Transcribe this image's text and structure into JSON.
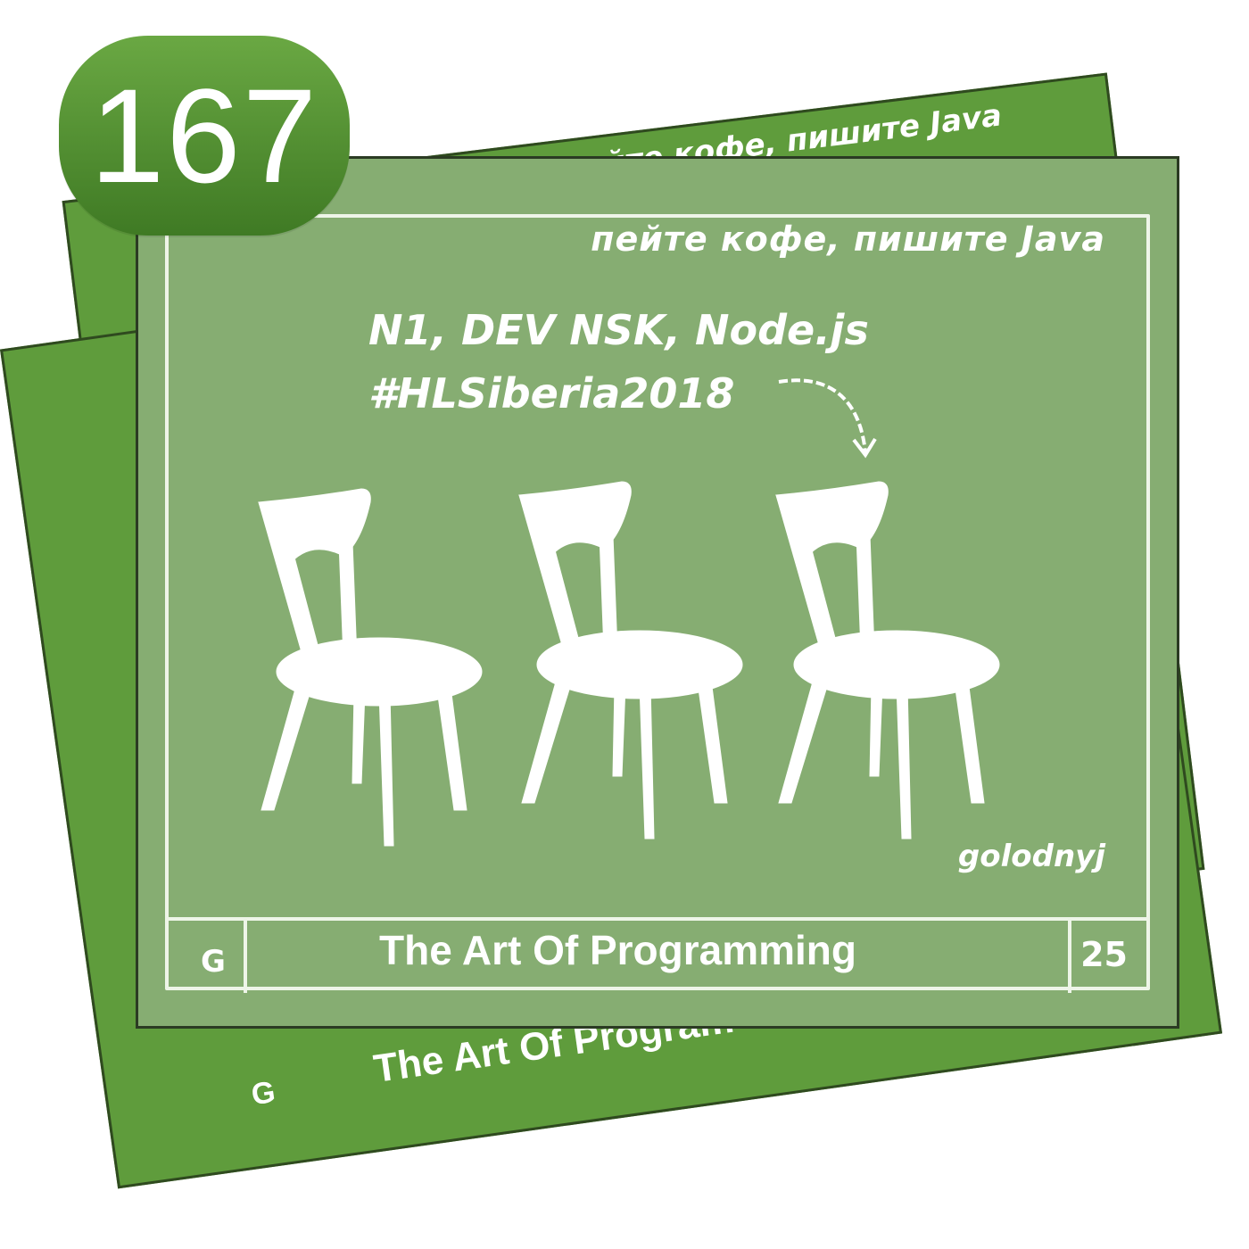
{
  "badge": {
    "number": "167"
  },
  "card": {
    "motto": "пейте кофе, пишите Java",
    "caption_line_1": "N1, DEV NSK, Node.js",
    "caption_line_2": "#HLSiberia2018",
    "author": "golodnyj",
    "footer_title": "The Art Of Programming",
    "footer_letter": "G",
    "footer_number": "25"
  },
  "back_card": {
    "motto_partial": "йте кофе, пишите Java",
    "title_partial": "The Art Of Program",
    "letter": "G"
  },
  "colors": {
    "card_front": "#86ad72",
    "card_back": "#5f9c3c",
    "badge": "#4f8c2e",
    "sketch": "#eef5e8"
  },
  "icons": [
    "chair-icon",
    "chair-icon",
    "chair-icon",
    "curved-arrow-icon"
  ]
}
